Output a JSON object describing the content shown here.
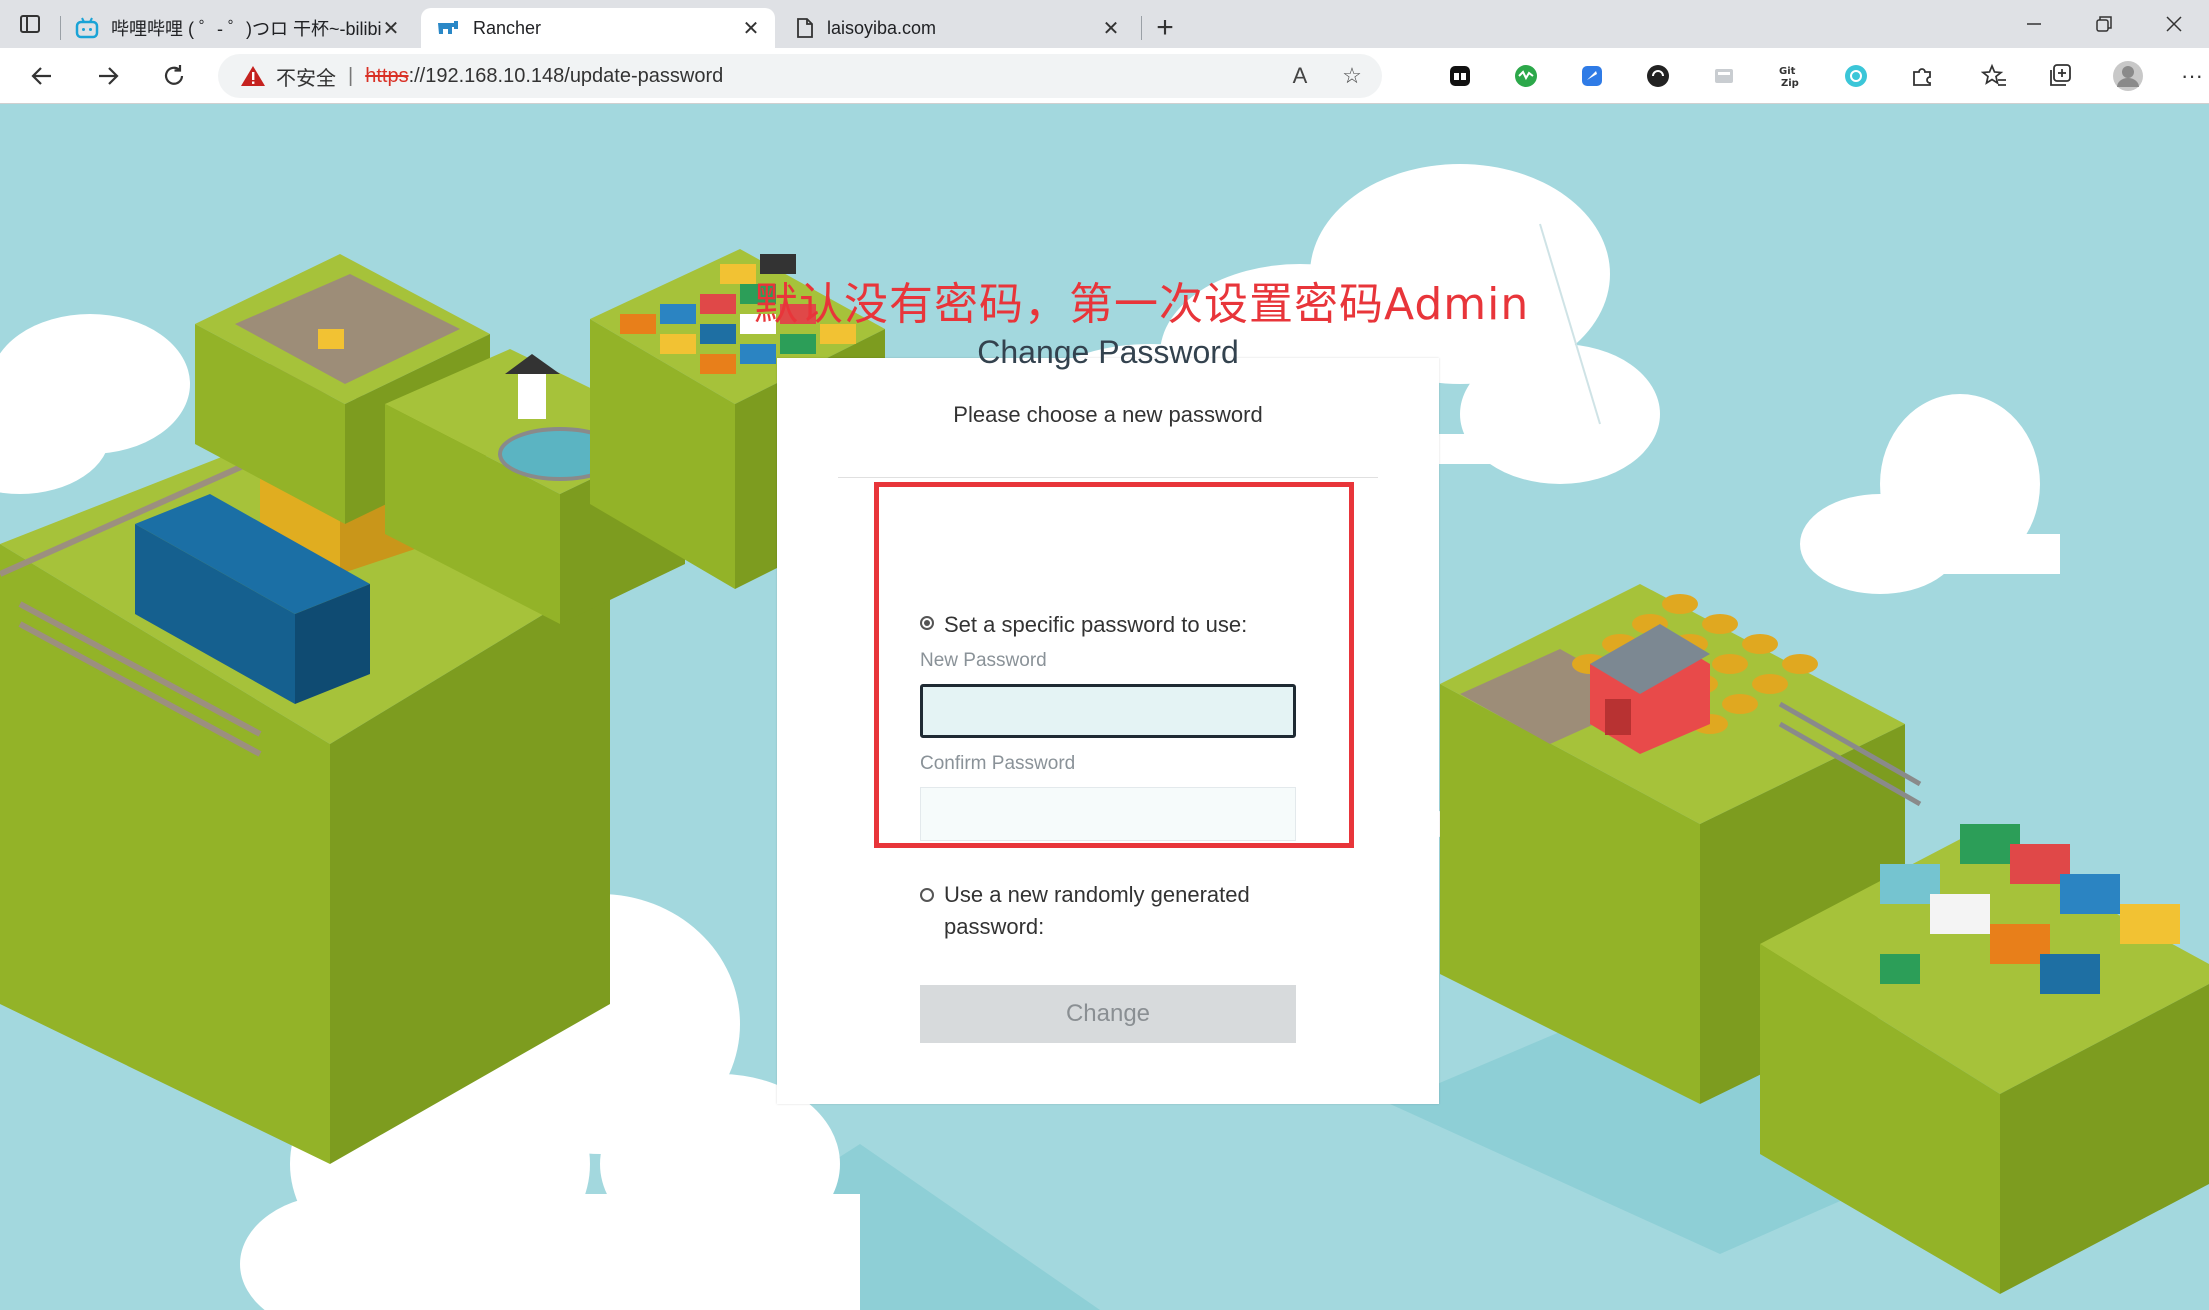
{
  "browser": {
    "tabs": [
      {
        "title": "哔哩哔哩 ( ゜- ゜)つロ 干杯~-bilibili",
        "icon": "bilibili-icon",
        "active": false
      },
      {
        "title": "Rancher",
        "icon": "rancher-icon",
        "active": true
      },
      {
        "title": "laisoyiba.com",
        "icon": "document-icon",
        "active": false
      }
    ],
    "address_bar": {
      "security_label": "不安全",
      "separator": "|",
      "url_scheme": "https",
      "url_rest": "://192.168.10.148/update-password"
    }
  },
  "annotation": {
    "text": "默认没有密码，第一次设置密码Admin",
    "color": "#e8353a"
  },
  "dialog": {
    "title": "Change Password",
    "subtitle": "Please choose a new password",
    "option_specific": {
      "label": "Set a specific password to use:",
      "selected": true
    },
    "new_password_label": "New Password",
    "new_password_value": "",
    "confirm_password_label": "Confirm Password",
    "confirm_password_value": "",
    "option_random": {
      "label": "Use a new randomly generated password:",
      "selected": false
    },
    "change_button": "Change",
    "change_button_enabled": false
  },
  "colors": {
    "sky": "#a3d8de",
    "grass_top": "#a6c23a",
    "grass_side": "#8aaa22",
    "highlight_box": "#e8353a"
  }
}
